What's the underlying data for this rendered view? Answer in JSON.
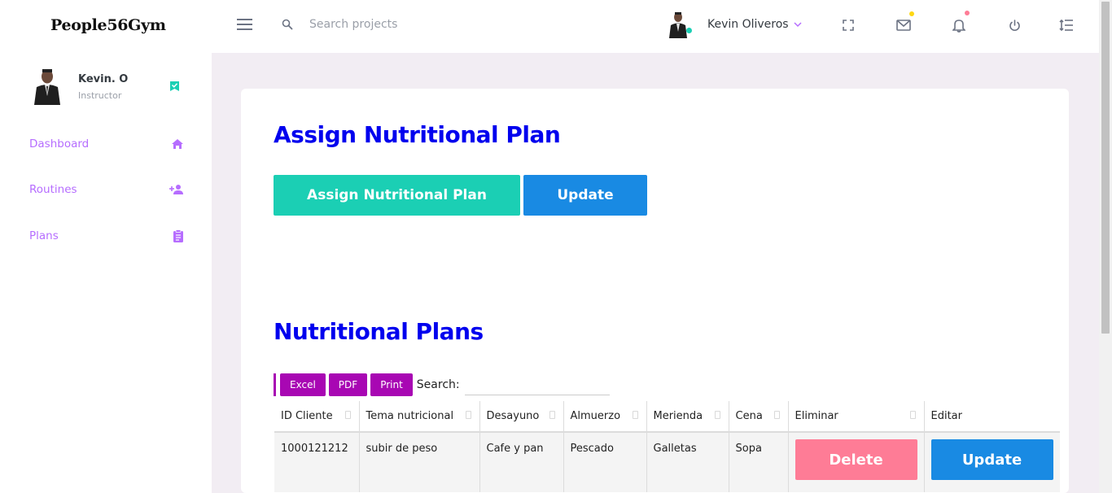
{
  "app": {
    "brand": "People56Gym"
  },
  "header": {
    "search_placeholder": "Search projects",
    "user_name": "Kevin Oliveros"
  },
  "sidebar": {
    "user": {
      "name": "Kevin. O",
      "role": "Instructor"
    },
    "items": [
      {
        "label": "Dashboard",
        "icon": "home-icon"
      },
      {
        "label": "Routines",
        "icon": "person-add-icon"
      },
      {
        "label": "Plans",
        "icon": "clipboard-icon"
      }
    ]
  },
  "main": {
    "assign_title": "Assign Nutritional Plan",
    "assign_button": "Assign Nutritional Plan",
    "update_button": "Update",
    "plans_title": "Nutritional Plans",
    "export": {
      "excel": "Excel",
      "pdf": "PDF",
      "print": "Print",
      "search_label": "Search:"
    },
    "table": {
      "columns": [
        "ID Cliente",
        "Tema nutricional",
        "Desayuno",
        "Almuerzo",
        "Merienda",
        "Cena",
        "Eliminar",
        "Editar"
      ],
      "rows": [
        {
          "id": "1000121212",
          "tema": "subir de peso",
          "desayuno": "Cafe y pan",
          "almuerzo": "Pescado",
          "merienda": "Galletas",
          "cena": "Sopa",
          "delete_label": "Delete",
          "update_label": "Update"
        }
      ]
    }
  },
  "colors": {
    "primary": "#b66dff",
    "success": "#1bcfb4",
    "info": "#198ae3",
    "danger": "#fe7c96",
    "title": "#0000ee",
    "export": "#a807b3"
  }
}
